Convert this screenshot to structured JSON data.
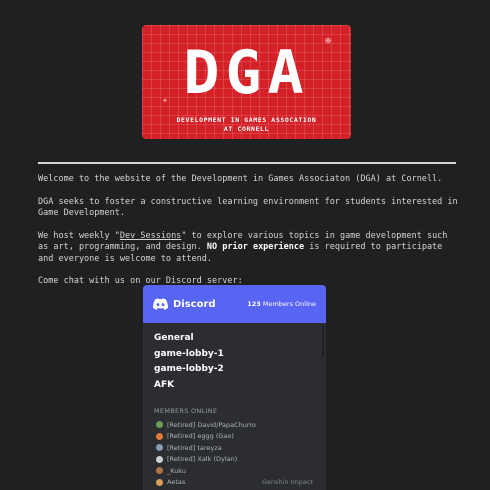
{
  "logo": {
    "mark": "DGA",
    "subtitle_line1": "DEVELOPMENT IN GAMES ASSOCATION",
    "subtitle_line2": "AT CORNELL"
  },
  "intro": {
    "p1": "Welcome to the website of the Development in Games Associaton (DGA) at Cornell.",
    "p2": "DGA seeks to foster a constructive learning environment for students interested in Game Development.",
    "p3_before": "We host weekly \"",
    "p3_link": "Dev Sessions",
    "p3_middle": "\" to explore various topics in game development such as art, programming, and design. ",
    "p3_bold": "NO prior experience",
    "p3_after": " is required to participate and everyone is welcome to attend.",
    "p4": "Come chat with us on our Discord server:"
  },
  "discord": {
    "brand": "Discord",
    "online_count": "123",
    "online_label": "Members Online",
    "channels": [
      "General",
      "game-lobby-1",
      "game-lobby-2",
      "AFK"
    ],
    "members_header": "MEMBERS ONLINE",
    "members": [
      {
        "name": "[Retired] David/PapaChurro",
        "avatar_color": "#6a9e5a",
        "game": ""
      },
      {
        "name": "[Retired] eggg (Gao)",
        "avatar_color": "#e07a3a",
        "game": ""
      },
      {
        "name": "[Retired] tareyza",
        "avatar_color": "#8b9bb0",
        "game": ""
      },
      {
        "name": "[Retired] Xalk (Dylan)",
        "avatar_color": "#c9d0d8",
        "game": ""
      },
      {
        "name": "_Kuku",
        "avatar_color": "#b0744a",
        "game": ""
      },
      {
        "name": "Aetas",
        "avatar_color": "#d9a05a",
        "game": "Genshin Impact"
      }
    ]
  },
  "colors": {
    "page_bg": "#1f2022",
    "logo_red": "#d42027",
    "discord_blurple": "#5865f2",
    "discord_bg": "#2b2d31"
  }
}
